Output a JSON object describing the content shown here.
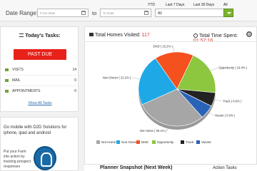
{
  "filters": {
    "date_range_label": "Date Range:",
    "from_placeholder": "From Date",
    "to_label": "to",
    "to_placeholder": "To Date",
    "quick_ytd": "YTD",
    "quick_7": "Last 7 Days",
    "quick_30": "Last 30 Days",
    "quick_all": "All",
    "select_value": "All"
  },
  "tasks": {
    "title": "Today's Tasks:",
    "past_due": "PAST DUE",
    "rows": [
      {
        "label": "VISITS",
        "count": "14"
      },
      {
        "label": "MAIL",
        "count": "0"
      },
      {
        "label": "APPOINTMENTS",
        "count": "0"
      }
    ],
    "show_all": "Show All Tasks"
  },
  "promo": {
    "title": "Go mobile with D2D Solutions for iphone, ipad and android",
    "text": "Put your Farm into action by tracking prospect responses"
  },
  "stats": {
    "visited_label": "Total Homes Visited:",
    "visited_value": "117",
    "time_label": "Total Time Spent:",
    "time_value": "01:57:16"
  },
  "colors": {
    "not_home": "#a6a6a6",
    "non_owner": "#1fa8e6",
    "dnd": "#f4511e",
    "opportunity": "#8dc63f",
    "track": "#222222",
    "vacant": "#2a62b8"
  },
  "chart_data": {
    "type": "pie",
    "title": "",
    "slices": [
      {
        "name": "Not Home",
        "label": "Not Home",
        "value": 29.1
      },
      {
        "name": "Non-Owner",
        "label": "Non-Owner",
        "value": 22.2
      },
      {
        "name": "DND",
        "label": "DND",
        "value": 16.2
      },
      {
        "name": "Opportunity",
        "label": "Opportunity",
        "value": 19.4
      },
      {
        "name": "Track",
        "label": "Track",
        "value": 6.0
      },
      {
        "name": "Vacant",
        "label": "Vacant",
        "value": 6.0
      }
    ],
    "legend_placement": "bottom"
  },
  "bottom": {
    "planner_title": "Planner Snapshot (Next Week)",
    "right_title": "Action Tasks"
  }
}
